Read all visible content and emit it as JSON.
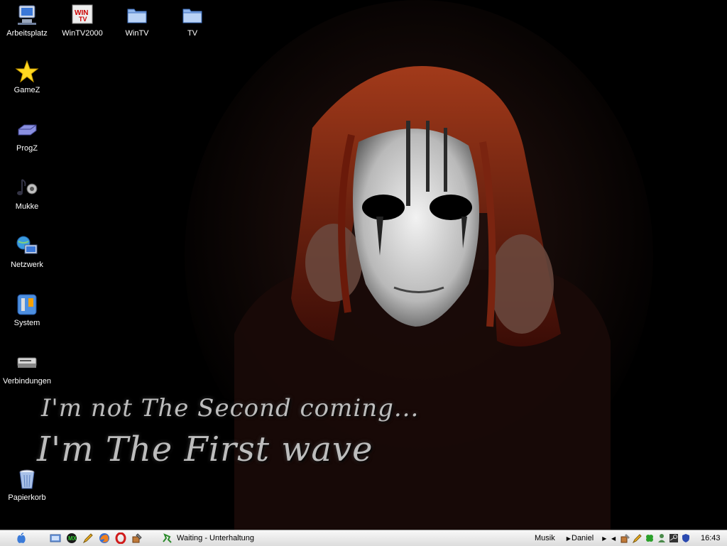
{
  "desktop": {
    "icons": [
      {
        "label": "Arbeitsplatz",
        "icon": "computer-icon"
      },
      {
        "label": "WinTV2000",
        "icon": "wintv-icon"
      },
      {
        "label": "WinTV",
        "icon": "folder-icon"
      },
      {
        "label": "TV",
        "icon": "folder-icon"
      },
      {
        "label": "GameZ",
        "icon": "star-icon"
      },
      {
        "label": "ProgZ",
        "icon": "drive-icon"
      },
      {
        "label": "Mukke",
        "icon": "music-icon"
      },
      {
        "label": "Netzwerk",
        "icon": "network-icon"
      },
      {
        "label": "System",
        "icon": "system-icon"
      },
      {
        "label": "Verbindungen",
        "icon": "connections-icon"
      },
      {
        "label": "Papierkorb",
        "icon": "trash-icon"
      }
    ],
    "wallpaper_text": {
      "line1": "I'm not The Second coming...",
      "line2": "I'm The First wave"
    }
  },
  "taskbar": {
    "quicklaunch": [
      "finder-icon",
      "mx-icon",
      "pencil-icon",
      "firefox-icon",
      "opera-icon",
      "tool-icon"
    ],
    "task": {
      "label": "Waiting - Unterhaltung",
      "icon": "chat-icon"
    },
    "menus": [
      "Musik",
      "Daniel"
    ],
    "tray": [
      "tool-icon",
      "pencil-icon",
      "clover-icon",
      "user-icon",
      "steam-icon",
      "shield-icon"
    ],
    "clock": "16:43"
  },
  "colors": {
    "taskbar_bg": "#e9e9e9",
    "desktop_bg": "#000000",
    "hair": "#8a2a10"
  }
}
